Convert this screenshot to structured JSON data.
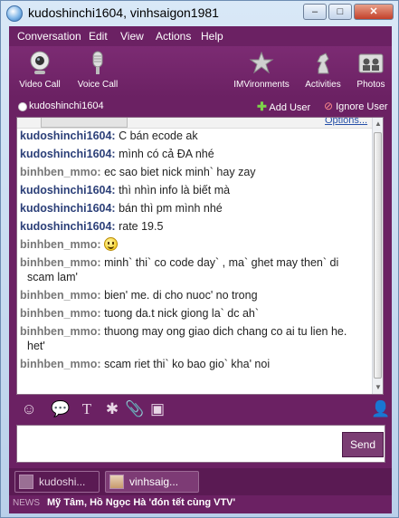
{
  "window": {
    "title": "kudoshinchi1604, vinhsaigon1981",
    "controls": {
      "minimize": "–",
      "maximize": "□",
      "close": "✕"
    }
  },
  "menu": [
    "Conversation",
    "Edit",
    "View",
    "Actions",
    "Help"
  ],
  "toolbar": {
    "video_call": "Video Call",
    "voice_call": "Voice Call",
    "imvironments": "IMVironments",
    "activities": "Activities",
    "photos": "Photos"
  },
  "user_bar": {
    "status_user": "kudoshinchi1604",
    "add_user": "Add User",
    "ignore_user": "Ignore User"
  },
  "chat": {
    "options_link": "Options...",
    "messages": [
      {
        "sender": "kudoshinchi1604:",
        "text": "C bán ecode ak"
      },
      {
        "sender": "kudoshinchi1604:",
        "text": "mình có cả ĐA nhé"
      },
      {
        "sender": "binhben_mmo:",
        "text": "ec sao biet nick minh` hay zay"
      },
      {
        "sender": "kudoshinchi1604:",
        "text": "thì nhìn info là biết mà"
      },
      {
        "sender": "kudoshinchi1604:",
        "text": "bán thì pm mình nhé"
      },
      {
        "sender": "kudoshinchi1604:",
        "text": "rate 19.5"
      },
      {
        "sender": "binhben_mmo:",
        "text": ""
      },
      {
        "sender": "binhben_mmo:",
        "text": "minh` thi` co code day` , ma` ghet may then` di",
        "text2": "scam lam'"
      },
      {
        "sender": "binhben_mmo:",
        "text": "bien' me. di cho nuoc' no trong"
      },
      {
        "sender": "binhben_mmo:",
        "text": "tuong da.t nick giong la` dc ah`"
      },
      {
        "sender": "binhben_mmo:",
        "text": "thuong may ong giao dich chang co ai tu lien he.",
        "text2": "het'"
      },
      {
        "sender": "binhben_mmo:",
        "text": "scam riet thi` ko bao gio` kha' noi"
      }
    ]
  },
  "compose": {
    "send_label": "Send",
    "value": ""
  },
  "conversation_tabs": [
    {
      "label": "kudoshi..."
    },
    {
      "label": "vinhsaig..."
    }
  ],
  "news": {
    "label": "NEWS",
    "headline": "Mỹ Tâm, Hồ Ngọc Hà 'đón tết cùng VTV'"
  },
  "colors": {
    "window_purple": "#6b2163",
    "sender_self": "#2b3f78",
    "sender_other": "#777777"
  }
}
